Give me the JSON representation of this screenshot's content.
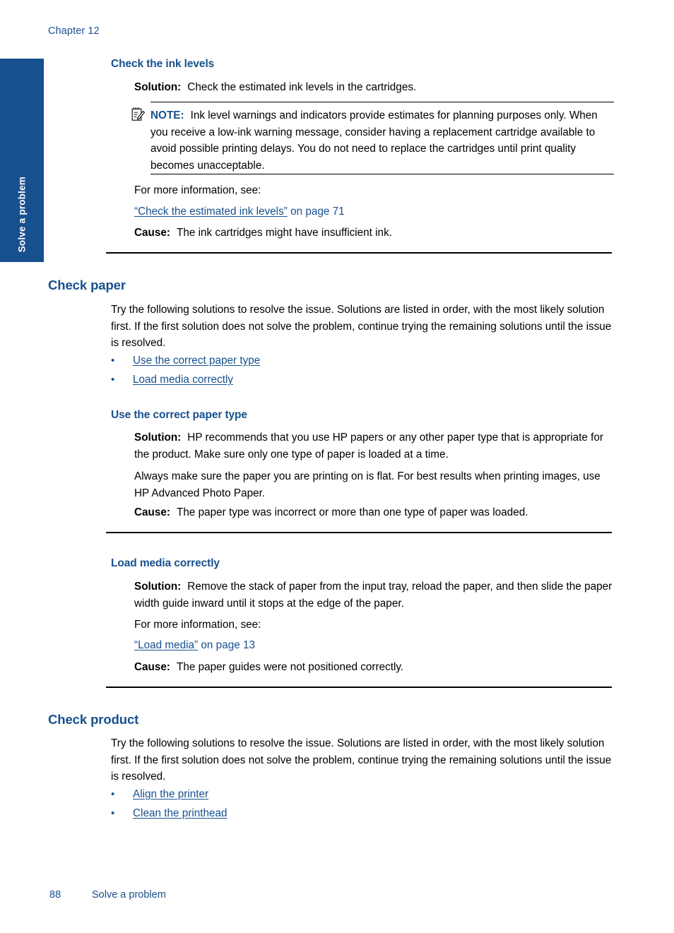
{
  "page": {
    "chapter_header": "Chapter 12",
    "side_tab_label": "Solve a problem",
    "footer_page_number": "88",
    "footer_title": "Solve a problem",
    "accent_blue": "#17508e",
    "link_blue": "#17508e",
    "body_black": "#000000"
  },
  "sections": {
    "check_ink_levels": {
      "heading": "Check the ink levels",
      "solution_label": "Solution:",
      "solution_text": "Check the estimated ink levels in the cartridges.",
      "note": {
        "icon_name": "note-pencil-icon",
        "label": "NOTE:",
        "text": "Ink level warnings and indicators provide estimates for planning purposes only. When you receive a low-ink warning message, consider having a replacement cartridge available to avoid possible printing delays. You do not need to replace the cartridges until print quality becomes unacceptable."
      },
      "more_info": "For more information, see:",
      "xref_open_quote": "“",
      "xref_link": "Check the estimated ink levels",
      "xref_close_quote": "”",
      "xref_tail": " on page 71",
      "cause_label": "Cause:",
      "cause_text": "The ink cartridges might have insufficient ink."
    },
    "check_paper": {
      "heading": "Check paper",
      "intro": "Try the following solutions to resolve the issue. Solutions are listed in order, with the most likely solution first. If the first solution does not solve the problem, continue trying the remaining solutions until the issue is resolved.",
      "bullets": [
        {
          "marker": "•",
          "label": "Use the correct paper type"
        },
        {
          "marker": "•",
          "label": "Load media correctly"
        }
      ],
      "sub_paper_type": {
        "heading": "Use the correct paper type",
        "solution_label": "Solution:",
        "solution_text": "HP recommends that you use HP papers or any other paper type that is appropriate for the product. Make sure only one type of paper is loaded at a time.",
        "second_para": "Always make sure the paper you are printing on is flat. For best results when printing images, use HP Advanced Photo Paper.",
        "cause_label": "Cause:",
        "cause_text": "The paper type was incorrect or more than one type of paper was loaded."
      },
      "sub_load_media": {
        "heading": "Load media correctly",
        "solution_label": "Solution:",
        "solution_text": "Remove the stack of paper from the input tray, reload the paper, and then slide the paper width guide inward until it stops at the edge of the paper.",
        "more_info": "For more information, see:",
        "xref_open_quote": "“",
        "xref_link": "Load media",
        "xref_close_quote": "”",
        "xref_tail": " on page 13",
        "cause_label": "Cause:",
        "cause_text": "The paper guides were not positioned correctly."
      }
    },
    "check_product": {
      "heading": "Check product",
      "intro": "Try the following solutions to resolve the issue. Solutions are listed in order, with the most likely solution first. If the first solution does not solve the problem, continue trying the remaining solutions until the issue is resolved.",
      "bullets": [
        {
          "marker": "•",
          "label": "Align the printer"
        },
        {
          "marker": "•",
          "label": "Clean the printhead"
        }
      ]
    }
  }
}
